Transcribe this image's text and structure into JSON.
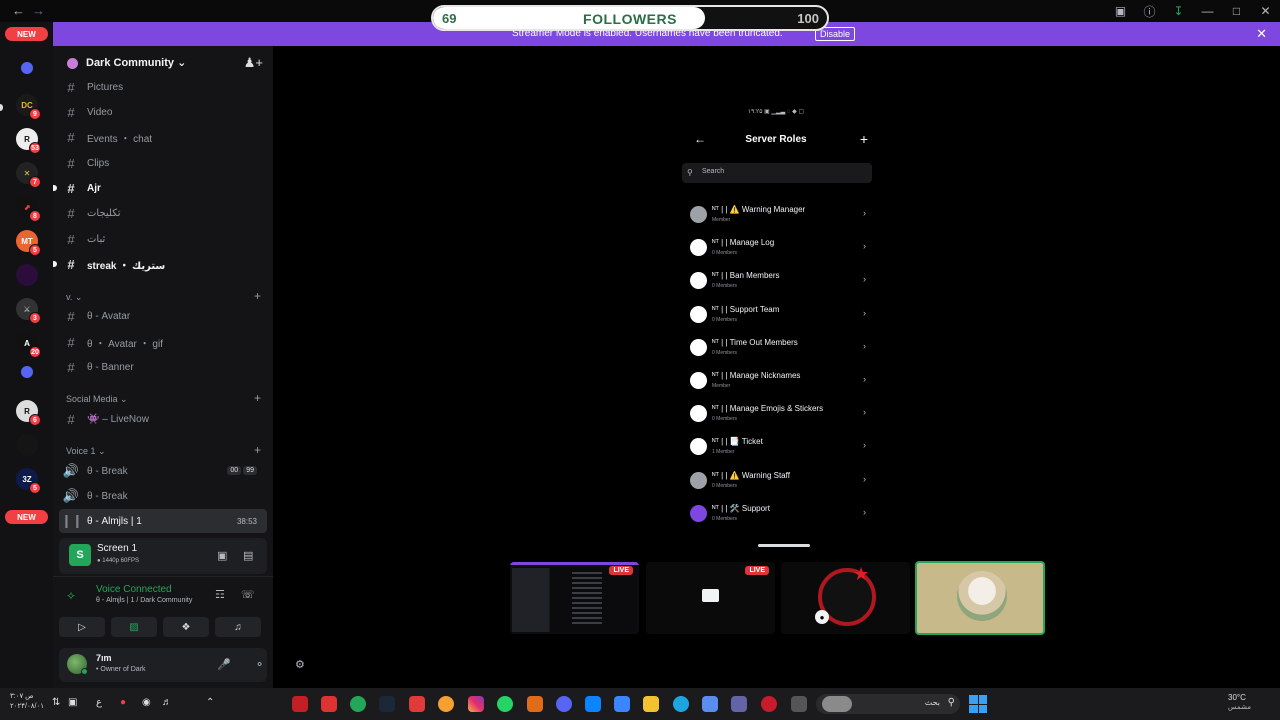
{
  "followers": {
    "current": "69",
    "label": "FOLLOWERS",
    "goal": "100",
    "progress": 0.69
  },
  "banner": {
    "text": "Streamer Mode is enabled. Usernames have been truncated.",
    "button": "Disable"
  },
  "rail": {
    "new_top": "NEW",
    "new_bottom": "NEW",
    "badges": [
      "9",
      "53",
      "7",
      "8",
      "5",
      "3",
      "20",
      "6",
      "5"
    ]
  },
  "guild": {
    "name": "Dark Community ⌄"
  },
  "channels": [
    {
      "label": "Pictures"
    },
    {
      "label": "Video"
    },
    {
      "label": "Events ・ chat"
    },
    {
      "label": "Clips"
    },
    {
      "label": "Ajr"
    },
    {
      "label": "تكليجات"
    },
    {
      "label": "ثبات"
    },
    {
      "label": "streak ・ ستريك"
    }
  ],
  "categories": {
    "v": "v. ⌄",
    "social": "Social Media ⌄",
    "voice": "Voice 1 ⌄"
  },
  "channels2": [
    {
      "label": "θ - Avatar"
    },
    {
      "label": "θ ・ Avatar ・ gif"
    },
    {
      "label": "θ - Banner"
    }
  ],
  "social_channel": {
    "label": "👾 – LiveNow"
  },
  "voice_channels": [
    {
      "label": "θ - Break",
      "users": "00",
      "limit": "99"
    },
    {
      "label": "θ - Break"
    },
    {
      "label": "θ - Almjls | 1",
      "timer": "38:53"
    }
  ],
  "screen": {
    "icon": "S",
    "title": "Screen 1",
    "sub": "● 1440p 60FPS"
  },
  "voice": {
    "title": "Voice Connected",
    "sub": "θ - Almjls | 1 / Dark Community"
  },
  "user": {
    "name": "7ım",
    "status": "• Owner of Dark"
  },
  "phone": {
    "status": "۱۹:۲۵ ▣ ▁▂▃ ◌ ◆ ▢",
    "title": "Server Roles",
    "search_placeholder": "Search",
    "roles": [
      {
        "name": "ᴺᵀ | | ⚠️ Warning Manager",
        "members": "Member",
        "avatar": "grey"
      },
      {
        "name": "ᴺᵀ | | Manage Log",
        "members": "0 Members",
        "avatar": "white"
      },
      {
        "name": "ᴺᵀ | | Ban Members",
        "members": "0 Members",
        "avatar": "white"
      },
      {
        "name": "ᴺᵀ | | Support Team",
        "members": "0 Members",
        "avatar": "white"
      },
      {
        "name": "ᴺᵀ | | Time Out Members",
        "members": "0 Members",
        "avatar": "white"
      },
      {
        "name": "ᴺᵀ | | Manage Nicknames",
        "members": "Member",
        "avatar": "white"
      },
      {
        "name": "ᴺᵀ | | Manage Emojis & Stickers",
        "members": "0 Members",
        "avatar": "white"
      },
      {
        "name": "ᴺᵀ | | 📑 Ticket",
        "members": "1 Member",
        "avatar": "white"
      },
      {
        "name": "ᴺᵀ | | ⚠️ Warning Staff",
        "members": "0 Members",
        "avatar": "grey"
      },
      {
        "name": "ᴺᵀ | | 🛠️ Support",
        "members": "0 Members",
        "avatar": "purple"
      }
    ]
  },
  "stream_tiles": {
    "live": "LIVE"
  },
  "taskbar": {
    "time": "۳:۰۷ ص",
    "date": "۲۰۲۴/۰۸/۰۱",
    "lang": "ع",
    "search_text": "بحث",
    "temp": "30°C",
    "condition": "مشمس"
  },
  "colors": {
    "accent": "#7d47e0",
    "green": "#23a55a",
    "red": "#f23f43"
  }
}
